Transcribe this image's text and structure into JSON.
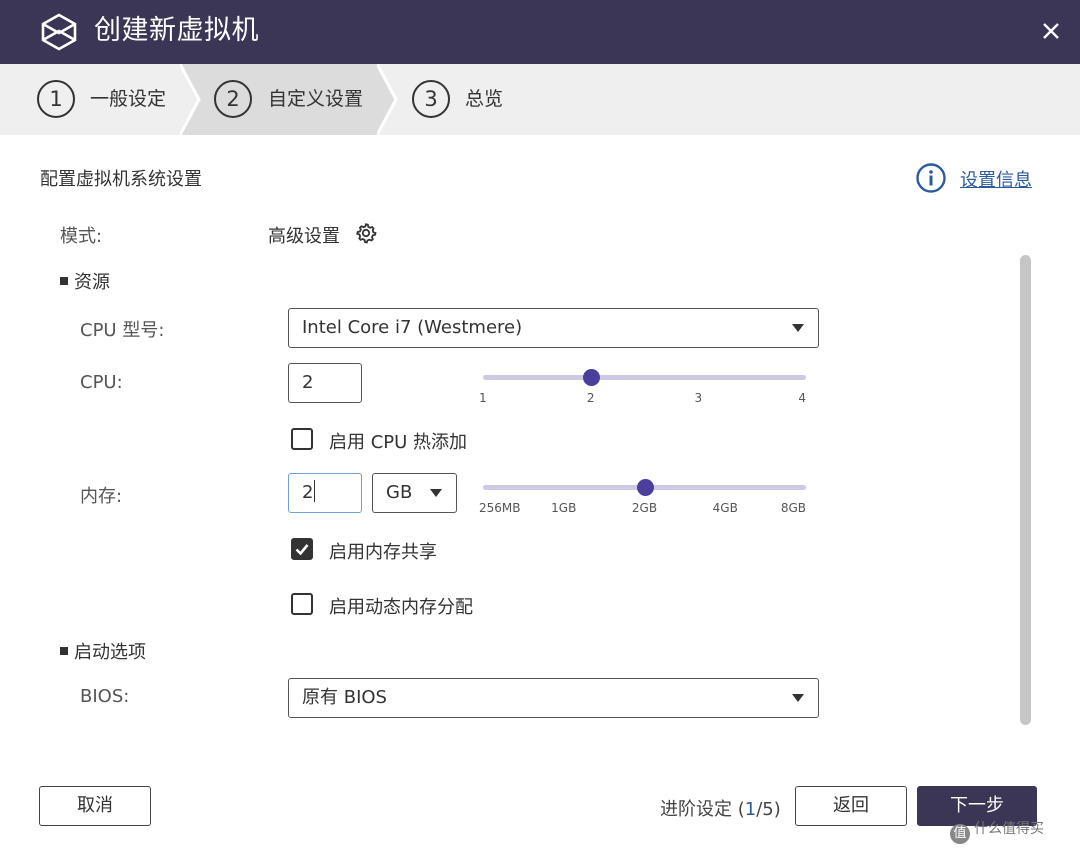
{
  "window": {
    "title": "创建新虚拟机",
    "close_glyph": "✕",
    "colors": {
      "titlebar": "#3b3656",
      "accent": "#4a3f9c",
      "link": "#2c5aa0"
    }
  },
  "steps": [
    {
      "number": "1",
      "label": "一般设定",
      "active": false
    },
    {
      "number": "2",
      "label": "自定义设置",
      "active": true
    },
    {
      "number": "3",
      "label": "总览",
      "active": false
    }
  ],
  "main": {
    "section_title": "配置虚拟机系统设置",
    "info_link": "设置信息",
    "mode": {
      "label": "模式:",
      "value": "高级设置",
      "icon": "gear-icon"
    },
    "resources": {
      "group_label": "资源",
      "cpu_model": {
        "label": "CPU 型号:",
        "value": "Intel Core i7 (Westmere)"
      },
      "cpu": {
        "label": "CPU:",
        "value": "2",
        "slider": {
          "ticks": [
            "1",
            "2",
            "3",
            "4"
          ],
          "selected_index": 1
        }
      },
      "cpu_hotplug": {
        "label": "启用 CPU 热添加",
        "checked": false
      },
      "memory": {
        "label": "内存:",
        "value": "2",
        "unit": "GB",
        "slider": {
          "ticks": [
            "256MB",
            "1GB",
            "2GB",
            "4GB",
            "8GB"
          ],
          "selected_index": 2
        }
      },
      "memory_sharing": {
        "label": "启用内存共享",
        "checked": true
      },
      "dynamic_memory": {
        "label": "启用动态内存分配",
        "checked": false
      }
    },
    "boot": {
      "group_label": "启动选项",
      "bios": {
        "label": "BIOS:",
        "value": "原有 BIOS"
      }
    }
  },
  "footer": {
    "cancel": "取消",
    "progress_prefix": "进阶设定 (",
    "progress_current": "1",
    "progress_suffix": "/5)",
    "back": "返回",
    "next": "下一步"
  },
  "watermark": {
    "badge": "值",
    "text": "什么值得买"
  }
}
